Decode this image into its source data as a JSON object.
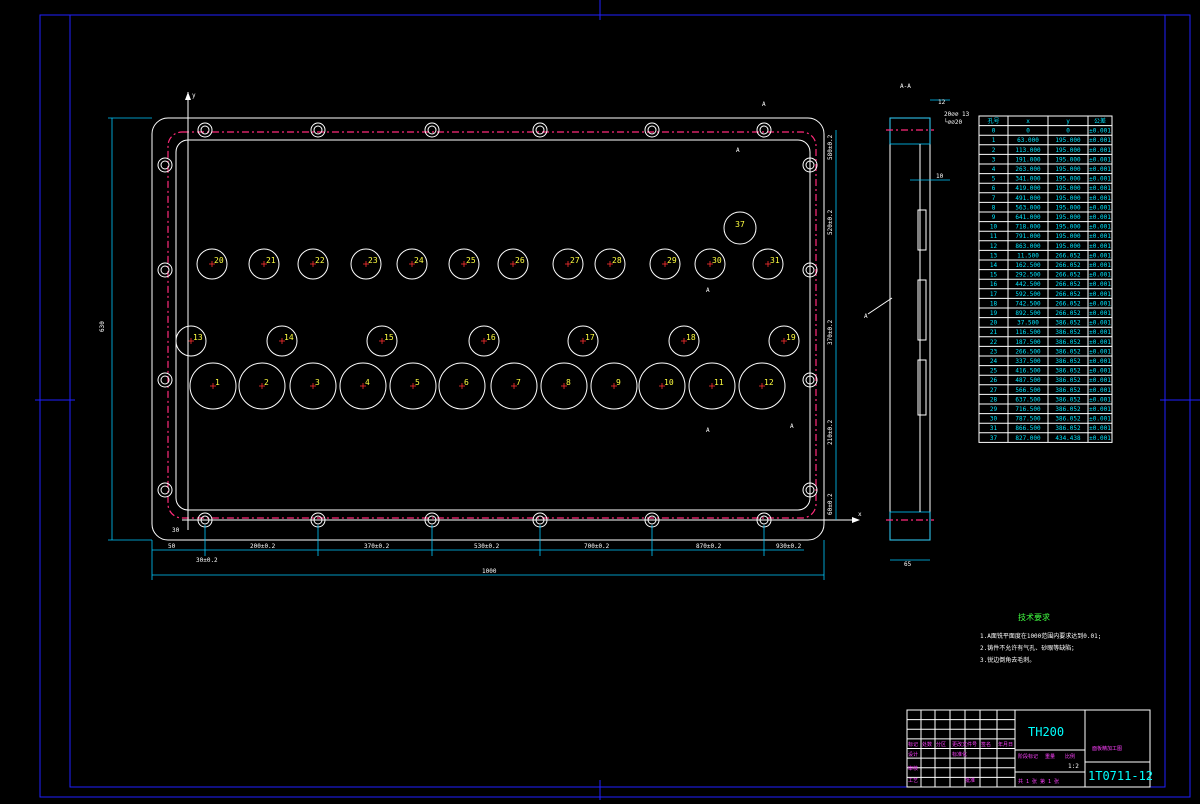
{
  "section": {
    "label": "A-A",
    "dim_12": "12",
    "dim_hole": "20⌀⌀ 13",
    "dim_hole2": "└⌀⌀20",
    "dim_10": "10",
    "dim_65": "65"
  },
  "section_markers": {
    "a": "A"
  },
  "axes": {
    "y": "y",
    "x": "x"
  },
  "dims": {
    "d50": "50",
    "d30": "30",
    "d30b": "30±0.2",
    "d200": "200±0.2",
    "d370": "370±0.2",
    "d530": "530±0.2",
    "d700": "700±0.2",
    "d870": "870±0.2",
    "d930": "930±0.2",
    "d1000": "1000",
    "d630": "630",
    "v580": "580±0.2",
    "v520": "520±0.2",
    "v370": "370±0.2",
    "v210": "210±0.2",
    "v60": "60±0.2"
  },
  "holes": {
    "big": [
      "1",
      "2",
      "3",
      "4",
      "5",
      "6",
      "7",
      "8",
      "9",
      "10",
      "11",
      "12"
    ],
    "mid": [
      "13",
      "14",
      "15",
      "16",
      "17",
      "18",
      "19"
    ],
    "top": [
      "20",
      "21",
      "22",
      "23",
      "24",
      "25",
      "26",
      "27",
      "28",
      "29",
      "30",
      "31"
    ],
    "special": "37"
  },
  "table": {
    "headers": [
      "孔号",
      "x",
      "y",
      "公差"
    ],
    "rows": [
      [
        "0",
        "0",
        "0",
        "±0.001"
      ],
      [
        "1",
        "63.000",
        "195.000",
        "±0.001"
      ],
      [
        "2",
        "113.000",
        "195.000",
        "±0.001"
      ],
      [
        "3",
        "191.000",
        "195.000",
        "±0.001"
      ],
      [
        "4",
        "263.000",
        "195.000",
        "±0.001"
      ],
      [
        "5",
        "341.000",
        "195.000",
        "±0.001"
      ],
      [
        "6",
        "419.000",
        "195.000",
        "±0.001"
      ],
      [
        "7",
        "491.000",
        "195.000",
        "±0.001"
      ],
      [
        "8",
        "563.000",
        "195.000",
        "±0.001"
      ],
      [
        "9",
        "641.000",
        "195.000",
        "±0.001"
      ],
      [
        "10",
        "718.000",
        "195.000",
        "±0.001"
      ],
      [
        "11",
        "791.000",
        "195.000",
        "±0.001"
      ],
      [
        "12",
        "863.000",
        "195.000",
        "±0.001"
      ],
      [
        "13",
        "11.500",
        "266.052",
        "±0.001"
      ],
      [
        "14",
        "162.500",
        "266.052",
        "±0.001"
      ],
      [
        "15",
        "292.500",
        "266.052",
        "±0.001"
      ],
      [
        "16",
        "442.500",
        "266.052",
        "±0.001"
      ],
      [
        "17",
        "592.500",
        "266.052",
        "±0.001"
      ],
      [
        "18",
        "742.500",
        "266.052",
        "±0.001"
      ],
      [
        "19",
        "892.500",
        "266.052",
        "±0.001"
      ],
      [
        "20",
        "37.500",
        "386.052",
        "±0.001"
      ],
      [
        "21",
        "116.500",
        "386.052",
        "±0.001"
      ],
      [
        "22",
        "187.500",
        "386.052",
        "±0.001"
      ],
      [
        "23",
        "266.500",
        "386.052",
        "±0.001"
      ],
      [
        "24",
        "337.500",
        "386.052",
        "±0.001"
      ],
      [
        "25",
        "416.500",
        "386.052",
        "±0.001"
      ],
      [
        "26",
        "487.500",
        "386.052",
        "±0.001"
      ],
      [
        "27",
        "566.500",
        "386.052",
        "±0.001"
      ],
      [
        "28",
        "637.500",
        "386.052",
        "±0.001"
      ],
      [
        "29",
        "716.500",
        "386.052",
        "±0.001"
      ],
      [
        "30",
        "787.500",
        "386.052",
        "±0.001"
      ],
      [
        "31",
        "866.500",
        "386.052",
        "±0.001"
      ],
      [
        "37",
        "827.000",
        "434.438",
        "±0.001"
      ]
    ]
  },
  "notes": {
    "title": "技术要求",
    "lines": [
      "1.A面铣平面度在1000范围内要求达到0.01;",
      "2.铸件不允许有气孔、砂眼等缺陷；",
      "3.锐边倒角去毛刺。"
    ]
  },
  "title_block": {
    "code": "TH200",
    "name": "面板精加工图",
    "number": "1T0711-12",
    "scale": "1:2",
    "sheet": "共 1 张 第 1 张",
    "labels": [
      "标记",
      "处数",
      "分区",
      "更改文件号",
      "签名",
      "年月日",
      "设计",
      "标准化",
      "阶段标记",
      "重量",
      "比例",
      "审核",
      "工艺",
      "批准"
    ]
  },
  "colors": {
    "bg": "#000000",
    "frame": "#2020ff",
    "line": "#ffffff",
    "dim": "#00c8ff",
    "center": "#ff2a7a",
    "label": "#ffff40"
  }
}
